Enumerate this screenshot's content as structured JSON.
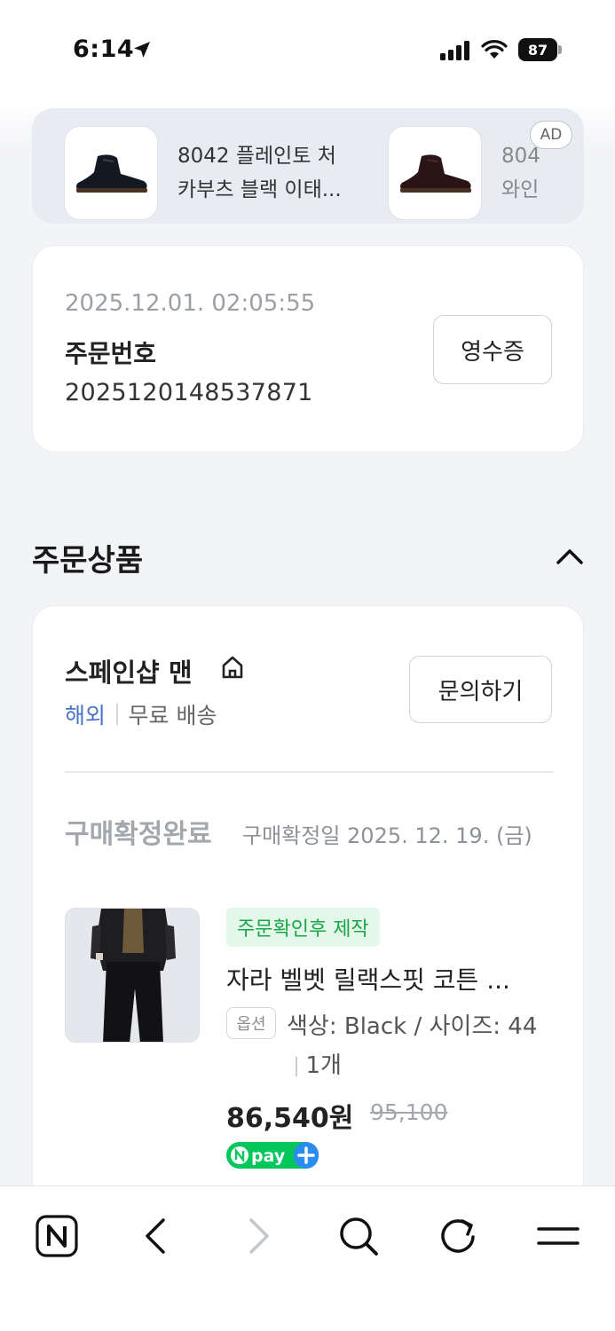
{
  "status_bar": {
    "time": "6:14",
    "battery": "87"
  },
  "ad_carousel": {
    "badge": "AD",
    "items": [
      {
        "title": "8042 플레인토 처",
        "title2": "카부츠 블랙 이태..."
      },
      {
        "title": "804",
        "title2": "와인"
      }
    ]
  },
  "order": {
    "datetime": "2025.12.01. 02:05:55",
    "number_label": "주문번호",
    "number": "2025120148537871",
    "receipt_button": "영수증"
  },
  "ordered_products": {
    "section_title": "주문상품",
    "shop": {
      "name": "스페인샵 맨",
      "tag_abroad": "해외",
      "tag_shipping": "무료 배송",
      "inquiry_button": "문의하기"
    },
    "status_label": "구매확정완료",
    "status_date": "구매확정일 2025. 12. 19. (금)",
    "item": {
      "tag": "주문확인후 제작",
      "name": "자라 벨벳 릴랙스핏 코튼 ...",
      "option_badge": "옵션",
      "option_text": "색상: Black / 사이즈: 44",
      "quantity": "1개",
      "price": "86,540원",
      "original_price": "95,100",
      "npay_label": "pay"
    }
  },
  "toolbar": {
    "icons": [
      "naver-icon",
      "back-icon",
      "forward-icon",
      "search-icon",
      "refresh-icon",
      "menu-icon"
    ]
  },
  "colors": {
    "background": "#f3f4f7",
    "accent_blue": "#4a72c8",
    "green_tag": "#1aa54b",
    "npay_green": "#03c75a"
  }
}
